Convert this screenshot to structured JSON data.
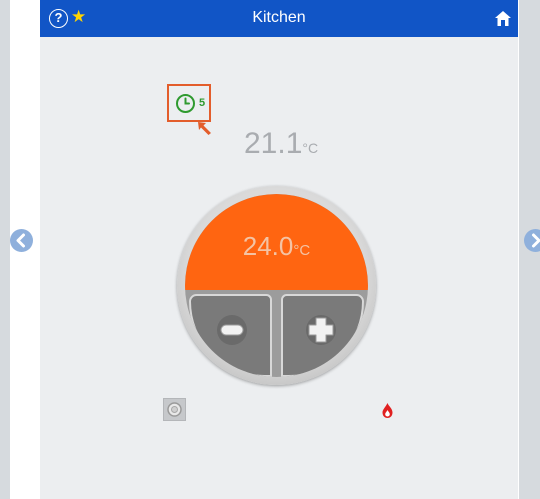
{
  "header": {
    "title": "Kitchen",
    "help_label": "?",
    "star_label": "★"
  },
  "schedule": {
    "count": "5"
  },
  "thermostat": {
    "current_value": "21.1",
    "current_unit": "°C",
    "setpoint_value": "24.0",
    "setpoint_unit": "°C"
  },
  "colors": {
    "header_blue": "#1155c6",
    "dial_orange": "#ff6511",
    "schedule_green": "#2f9a2f",
    "highlight_orange": "#e35d2b",
    "flame_red": "#e02020"
  },
  "icons": {
    "help": "help-icon",
    "favorite": "star-icon",
    "home": "home-icon",
    "schedule": "clock-icon",
    "previous": "chevron-left-icon",
    "next": "chevron-right-icon",
    "decrease": "minus-icon",
    "increase": "plus-icon",
    "mode": "mode-icon",
    "heating": "flame-icon"
  }
}
